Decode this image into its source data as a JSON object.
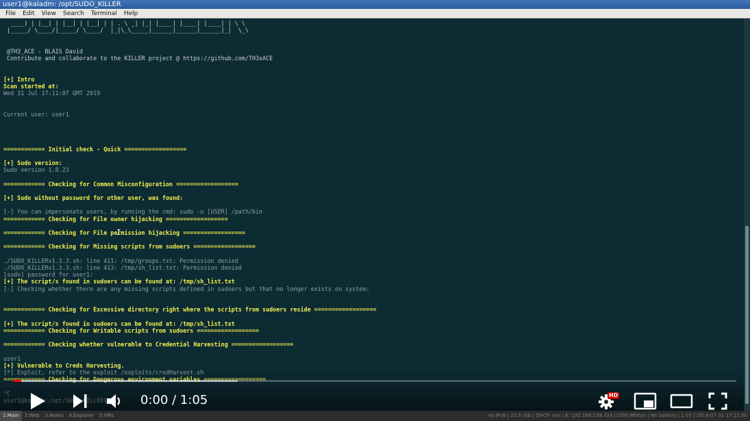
{
  "window": {
    "title": "user1@kaladm: /opt/SUDO_KILLER"
  },
  "menu": [
    "File",
    "Edit",
    "View",
    "Search",
    "Terminal",
    "Help"
  ],
  "terminal_lines": [
    {
      "cls": "ascii",
      "text": "  ____) | |__| | |__| | |__| | | . \\ _| |_| |____| |____| |____| | \\ \\"
    },
    {
      "cls": "ascii",
      "text": " |_____/ \\____/|_____/ \\____/  |_|\\_\\_____|______|______|______|_|  \\_\\"
    },
    {
      "cls": "",
      "text": ""
    },
    {
      "cls": "",
      "text": ""
    },
    {
      "cls": "w",
      "text": " @TH3_ACE - BLAIS David"
    },
    {
      "cls": "w",
      "text": " Contribute and collaborate to the KILLER project @ https://github.com/TH3xACE"
    },
    {
      "cls": "",
      "text": ""
    },
    {
      "cls": "",
      "text": ""
    },
    {
      "cls": "y",
      "text": "[+] Intro"
    },
    {
      "cls": "y",
      "text": "Scan started at:"
    },
    {
      "cls": "",
      "text": "Wed 31 Jul 17:11:07 GMT 2019"
    },
    {
      "cls": "",
      "text": ""
    },
    {
      "cls": "",
      "text": ""
    },
    {
      "cls": "",
      "text": "Current user: user1"
    },
    {
      "cls": "",
      "text": ""
    },
    {
      "cls": "",
      "text": ""
    },
    {
      "cls": "",
      "text": ""
    },
    {
      "cls": "",
      "text": ""
    },
    {
      "cls": "y",
      "text": "============ Initial check - Quick =================="
    },
    {
      "cls": "",
      "text": ""
    },
    {
      "cls": "y",
      "text": "[+] Sudo version:"
    },
    {
      "cls": "",
      "text": "Sudo version 1.8.23"
    },
    {
      "cls": "",
      "text": ""
    },
    {
      "cls": "y",
      "text": "============ Checking for Common Misconfiguration =================="
    },
    {
      "cls": "",
      "text": ""
    },
    {
      "cls": "y",
      "text": "[+] Sudo without password for other user, was found:"
    },
    {
      "cls": "",
      "text": ""
    },
    {
      "cls": "",
      "text": "[-] You can impersonate users, by running the cmd: sudo -u [USER] /path/bin"
    },
    {
      "cls": "y",
      "text": "============ Checking for File owner hijacking =================="
    },
    {
      "cls": "",
      "text": ""
    },
    {
      "cls": "y",
      "text": "============ Checking for File permission hijacking =================="
    },
    {
      "cls": "",
      "text": ""
    },
    {
      "cls": "y",
      "text": "============ Checking for Missing scripts from sudoers =================="
    },
    {
      "cls": "",
      "text": ""
    },
    {
      "cls": "",
      "text": "./SUDO_KILLERv1.3.3.sh: line 411: /tmp/groups.txt: Permission denied"
    },
    {
      "cls": "",
      "text": "./SUDO_KILLERv1.3.3.sh: line 413: /tmp/sh_list.txt: Permission denied"
    },
    {
      "cls": "",
      "text": "[sudo] password for user1:"
    },
    {
      "cls": "y",
      "text": "[+] The script/s found in sudoers can be found at: /tmp/sh_list.txt"
    },
    {
      "cls": "",
      "text": "[-] Checking whether there are any missing scripts defined in sudoers but that no longer exists on system:"
    },
    {
      "cls": "",
      "text": ""
    },
    {
      "cls": "",
      "text": ""
    },
    {
      "cls": "y",
      "text": "============ Checking for Excessive directory right where the scripts from sudoers reside =================="
    },
    {
      "cls": "",
      "text": ""
    },
    {
      "cls": "y",
      "text": "[+] The script/s found in sudoers can be found at: /tmp/sh_list.txt"
    },
    {
      "cls": "y",
      "text": "============ Checking for Writable scripts from sudoers =================="
    },
    {
      "cls": "",
      "text": ""
    },
    {
      "cls": "y",
      "text": "============ Checking whether vulnerable to Credential Harvesting =================="
    },
    {
      "cls": "",
      "text": ""
    },
    {
      "cls": "",
      "text": "user1"
    },
    {
      "cls": "y",
      "text": "[+] Vulnerable to Creds Harvesting."
    },
    {
      "cls": "",
      "text": "[*] Exploit, refer to the exploit /exploits/credHarvest.sh"
    },
    {
      "cls": "y",
      "text": "============ Checking for Dangerous environment variables =================="
    },
    {
      "cls": "",
      "text": ""
    },
    {
      "cls": "",
      "text": "^C"
    },
    {
      "cls": "",
      "text": "user1@kaladm:/opt/SUDO_KILLER$"
    }
  ],
  "player": {
    "time_display": "0:00 / 1:05",
    "hd_label": "HD",
    "played_fraction": 0.01,
    "loaded_fraction": 0.31
  },
  "taskbar": {
    "workspaces": [
      "1:Main",
      "2:Web",
      "3:Notes",
      "4:Explorer",
      "5:VMs"
    ],
    "status": "no IPv6 | 23.5 GiB | DHCP: yes | E: 192.168.159.324 (1000 Mbit/s) | No battery | 1.07 | 2019-07-31 17:11:50"
  },
  "colors": {
    "terminal_bg": "#0d2b33",
    "highlight_yellow": "#f2ef4e",
    "progress_red": "#ff0000"
  }
}
